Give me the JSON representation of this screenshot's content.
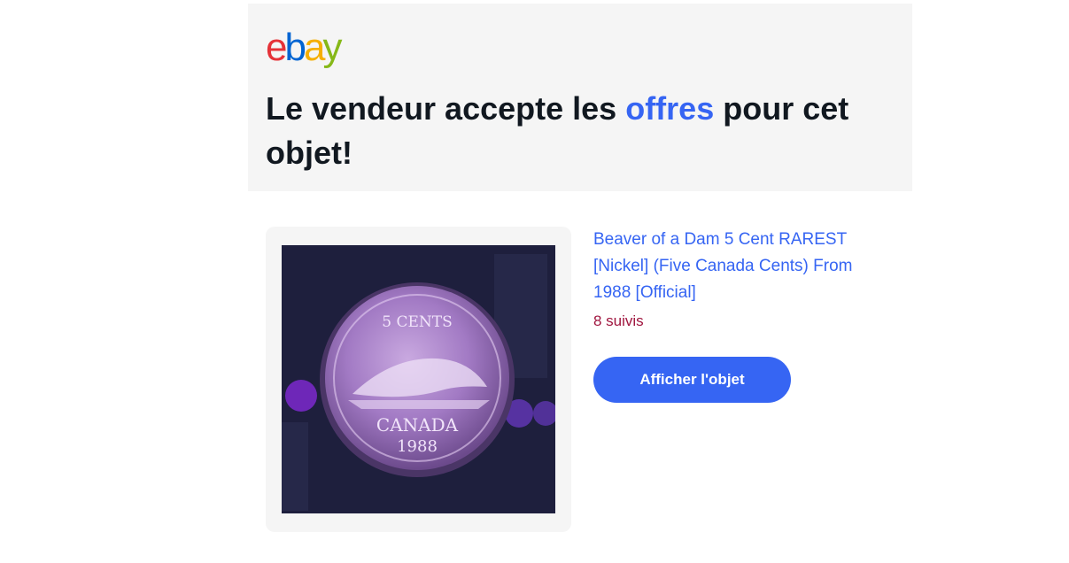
{
  "brand": {
    "logo_letters": [
      "e",
      "b",
      "a",
      "y"
    ],
    "logo_colors": [
      "#e53238",
      "#0064d2",
      "#f5af02",
      "#86b817"
    ]
  },
  "header": {
    "headline_before": "Le vendeur accepte les ",
    "headline_accent": "offres",
    "headline_after": " pour cet objet!",
    "accent_color": "#3665f3"
  },
  "item": {
    "image_icon": "coin-photo",
    "coin_text_top": "5 CENTS",
    "coin_text_country": "CANADA",
    "coin_text_year": "1988",
    "title": "Beaver of a Dam 5 Cent RAREST [Nickel] (Five Canada Cents) From 1988 [Official]",
    "watchers": "8 suivis",
    "cta_label": "Afficher l'objet"
  }
}
